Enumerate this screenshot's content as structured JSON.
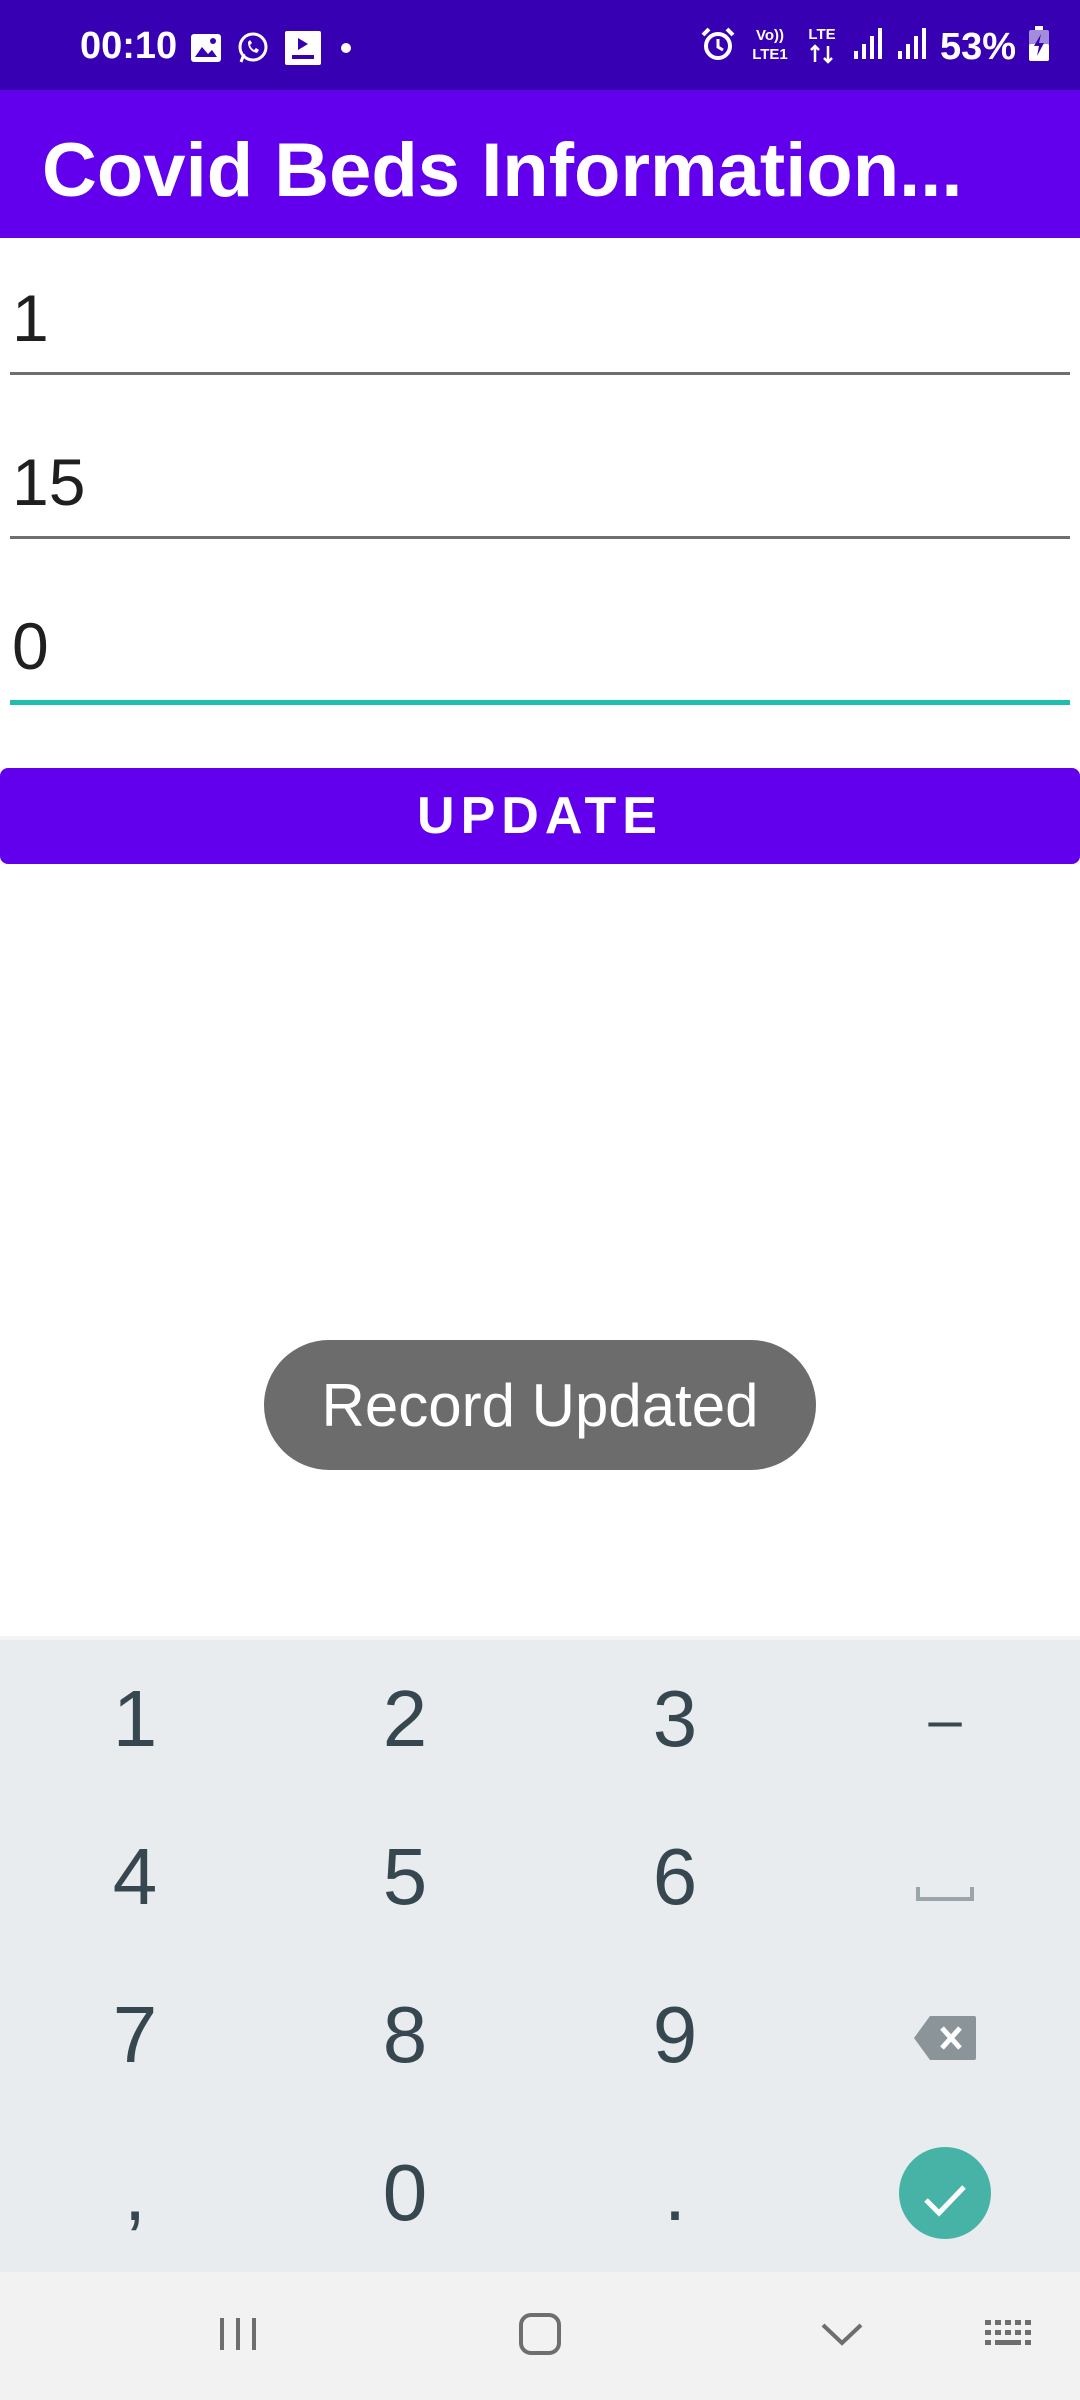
{
  "status_bar": {
    "time": "00:10",
    "battery": "53%",
    "left_icons": [
      "image-icon",
      "whatsapp-icon",
      "media-icon",
      "dot-icon"
    ],
    "right_icons": [
      "alarm-icon",
      "volte-icon",
      "lte-icon",
      "signal-icon",
      "signal-icon",
      "battery-charging-icon"
    ],
    "network_labels": {
      "volte": "Vo)) LTE1",
      "lte": "LTE"
    },
    "bg_color": "#3700b3"
  },
  "app_bar": {
    "title": "Covid Beds Information...",
    "bg_color": "#6200ee"
  },
  "form": {
    "fields": [
      {
        "value": "1"
      },
      {
        "value": "15"
      },
      {
        "value": "0"
      }
    ],
    "focused_field_index": 2,
    "update_button": "UPDATE",
    "accent_color": "#1ebfae"
  },
  "toast": {
    "message": "Record Updated"
  },
  "keyboard": {
    "rows": [
      [
        "1",
        "2",
        "3",
        "–"
      ],
      [
        "4",
        "5",
        "6",
        "space-icon"
      ],
      [
        "7",
        "8",
        "9",
        "backspace-icon"
      ],
      [
        ",",
        "0",
        ".",
        "done-icon"
      ]
    ],
    "keys": {
      "k1": "1",
      "k2": "2",
      "k3": "3",
      "dash": "–",
      "k4": "4",
      "k5": "5",
      "k6": "6",
      "k7": "7",
      "k8": "8",
      "k9": "9",
      "comma": ",",
      "k0": "0",
      "period": "."
    },
    "done_color": "#46b3a6"
  },
  "nav_bar": {
    "buttons": [
      "recents-icon",
      "home-icon",
      "back-icon",
      "keyboard-icon"
    ]
  }
}
